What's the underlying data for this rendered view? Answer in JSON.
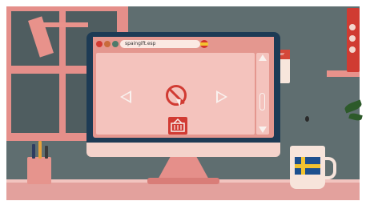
{
  "browser": {
    "url": "spaingift.esp"
  },
  "calendar": {
    "label": "ber"
  },
  "colors": {
    "wall": "#5f6e70",
    "accent": "#d13b33",
    "browser_frame": "#e4978f",
    "content_bg": "#f4c3bd"
  },
  "icons": {
    "prev": "chevron-left-icon",
    "next": "chevron-right-icon",
    "blocked": "no-entry-icon",
    "cart": "shopping-basket-icon",
    "cursor": "pointer-cursor-icon"
  }
}
